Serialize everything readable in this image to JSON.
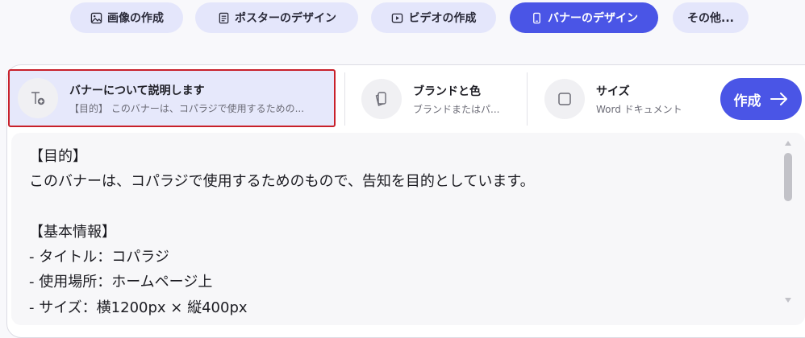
{
  "tabs": [
    {
      "label": "画像の作成",
      "icon": "image-icon"
    },
    {
      "label": "ポスターのデザイン",
      "icon": "document-icon"
    },
    {
      "label": "ビデオの作成",
      "icon": "video-play-icon"
    },
    {
      "label": "バナーのデザイン",
      "icon": "phone-icon",
      "active": true
    },
    {
      "label": "その他..."
    }
  ],
  "options": {
    "describe": {
      "title": "バナーについて説明します",
      "subtitle": "【目的】 このバナーは、コパラジで使用するための..."
    },
    "brand": {
      "title": "ブランドと色",
      "subtitle": "ブランドまたはパ..."
    },
    "size": {
      "title": "サイズ",
      "subtitle": "Word ドキュメント"
    }
  },
  "create_button": {
    "label": "作成"
  },
  "editor": {
    "text": "【目的】\nこのバナーは、コパラジで使用するためのもので、告知を目的としています。\n\n【基本情報】\n- タイトル：コパラジ\n- 使用場所：ホームページ上\n- サイズ：横1200px × 縦400px"
  },
  "colors": {
    "accent": "#4a55e6",
    "tab_bg": "#e4e6fb",
    "selected_option_bg": "#e6e8fb",
    "highlight_border": "#c8202a"
  }
}
